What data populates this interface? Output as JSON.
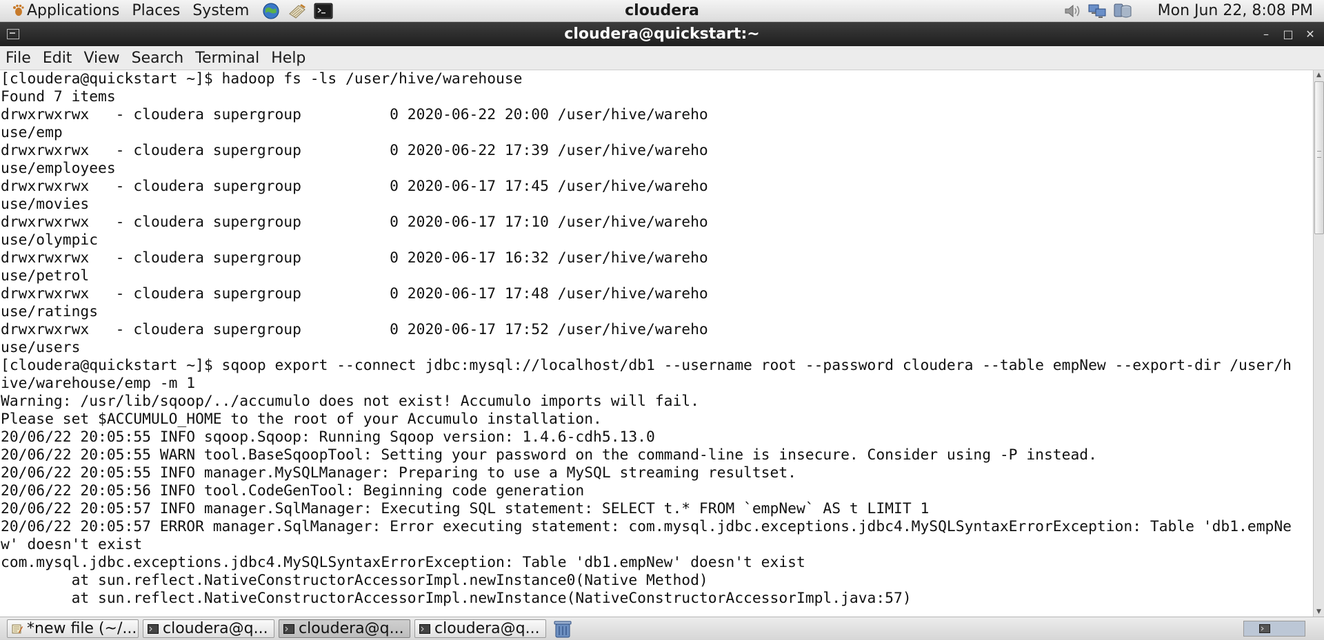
{
  "top_panel": {
    "menus": [
      "Applications",
      "Places",
      "System"
    ],
    "hostname": "cloudera",
    "clock": "Mon Jun 22,  8:08 PM",
    "icons": [
      "gnome-foot-icon",
      "web-browser-icon",
      "text-editor-icon",
      "terminal-launcher-icon",
      "volume-icon",
      "network-icon",
      "update-manager-icon"
    ]
  },
  "window": {
    "title": "cloudera@quickstart:~",
    "controls": [
      "minimize",
      "maximize",
      "close"
    ]
  },
  "menubar": {
    "items": [
      "File",
      "Edit",
      "View",
      "Search",
      "Terminal",
      "Help"
    ]
  },
  "terminal": {
    "lines": [
      "[cloudera@quickstart ~]$ hadoop fs -ls /user/hive/warehouse",
      "Found 7 items",
      "drwxrwxrwx   - cloudera supergroup          0 2020-06-22 20:00 /user/hive/wareho",
      "use/emp",
      "drwxrwxrwx   - cloudera supergroup          0 2020-06-22 17:39 /user/hive/wareho",
      "use/employees",
      "drwxrwxrwx   - cloudera supergroup          0 2020-06-17 17:45 /user/hive/wareho",
      "use/movies",
      "drwxrwxrwx   - cloudera supergroup          0 2020-06-17 17:10 /user/hive/wareho",
      "use/olympic",
      "drwxrwxrwx   - cloudera supergroup          0 2020-06-17 16:32 /user/hive/wareho",
      "use/petrol",
      "drwxrwxrwx   - cloudera supergroup          0 2020-06-17 17:48 /user/hive/wareho",
      "use/ratings",
      "drwxrwxrwx   - cloudera supergroup          0 2020-06-17 17:52 /user/hive/wareho",
      "use/users",
      "[cloudera@quickstart ~]$ sqoop export --connect jdbc:mysql://localhost/db1 --username root --password cloudera --table empNew --export-dir /user/h",
      "ive/warehouse/emp -m 1",
      "Warning: /usr/lib/sqoop/../accumulo does not exist! Accumulo imports will fail.",
      "Please set $ACCUMULO_HOME to the root of your Accumulo installation.",
      "20/06/22 20:05:55 INFO sqoop.Sqoop: Running Sqoop version: 1.4.6-cdh5.13.0",
      "20/06/22 20:05:55 WARN tool.BaseSqoopTool: Setting your password on the command-line is insecure. Consider using -P instead.",
      "20/06/22 20:05:55 INFO manager.MySQLManager: Preparing to use a MySQL streaming resultset.",
      "20/06/22 20:05:56 INFO tool.CodeGenTool: Beginning code generation",
      "20/06/22 20:05:57 INFO manager.SqlManager: Executing SQL statement: SELECT t.* FROM `empNew` AS t LIMIT 1",
      "20/06/22 20:05:57 ERROR manager.SqlManager: Error executing statement: com.mysql.jdbc.exceptions.jdbc4.MySQLSyntaxErrorException: Table 'db1.empNe",
      "w' doesn't exist",
      "com.mysql.jdbc.exceptions.jdbc4.MySQLSyntaxErrorException: Table 'db1.empNew' doesn't exist",
      "        at sun.reflect.NativeConstructorAccessorImpl.newInstance0(Native Method)",
      "        at sun.reflect.NativeConstructorAccessorImpl.newInstance(NativeConstructorAccessorImpl.java:57)"
    ]
  },
  "taskbar": {
    "tasks": [
      {
        "label": "*new file (~/...",
        "icon": "text-editor-icon",
        "active": false
      },
      {
        "label": "cloudera@q...",
        "icon": "terminal-icon",
        "active": false
      },
      {
        "label": "cloudera@q...",
        "icon": "terminal-icon",
        "active": true
      },
      {
        "label": "cloudera@q...",
        "icon": "terminal-icon",
        "active": false
      }
    ]
  }
}
